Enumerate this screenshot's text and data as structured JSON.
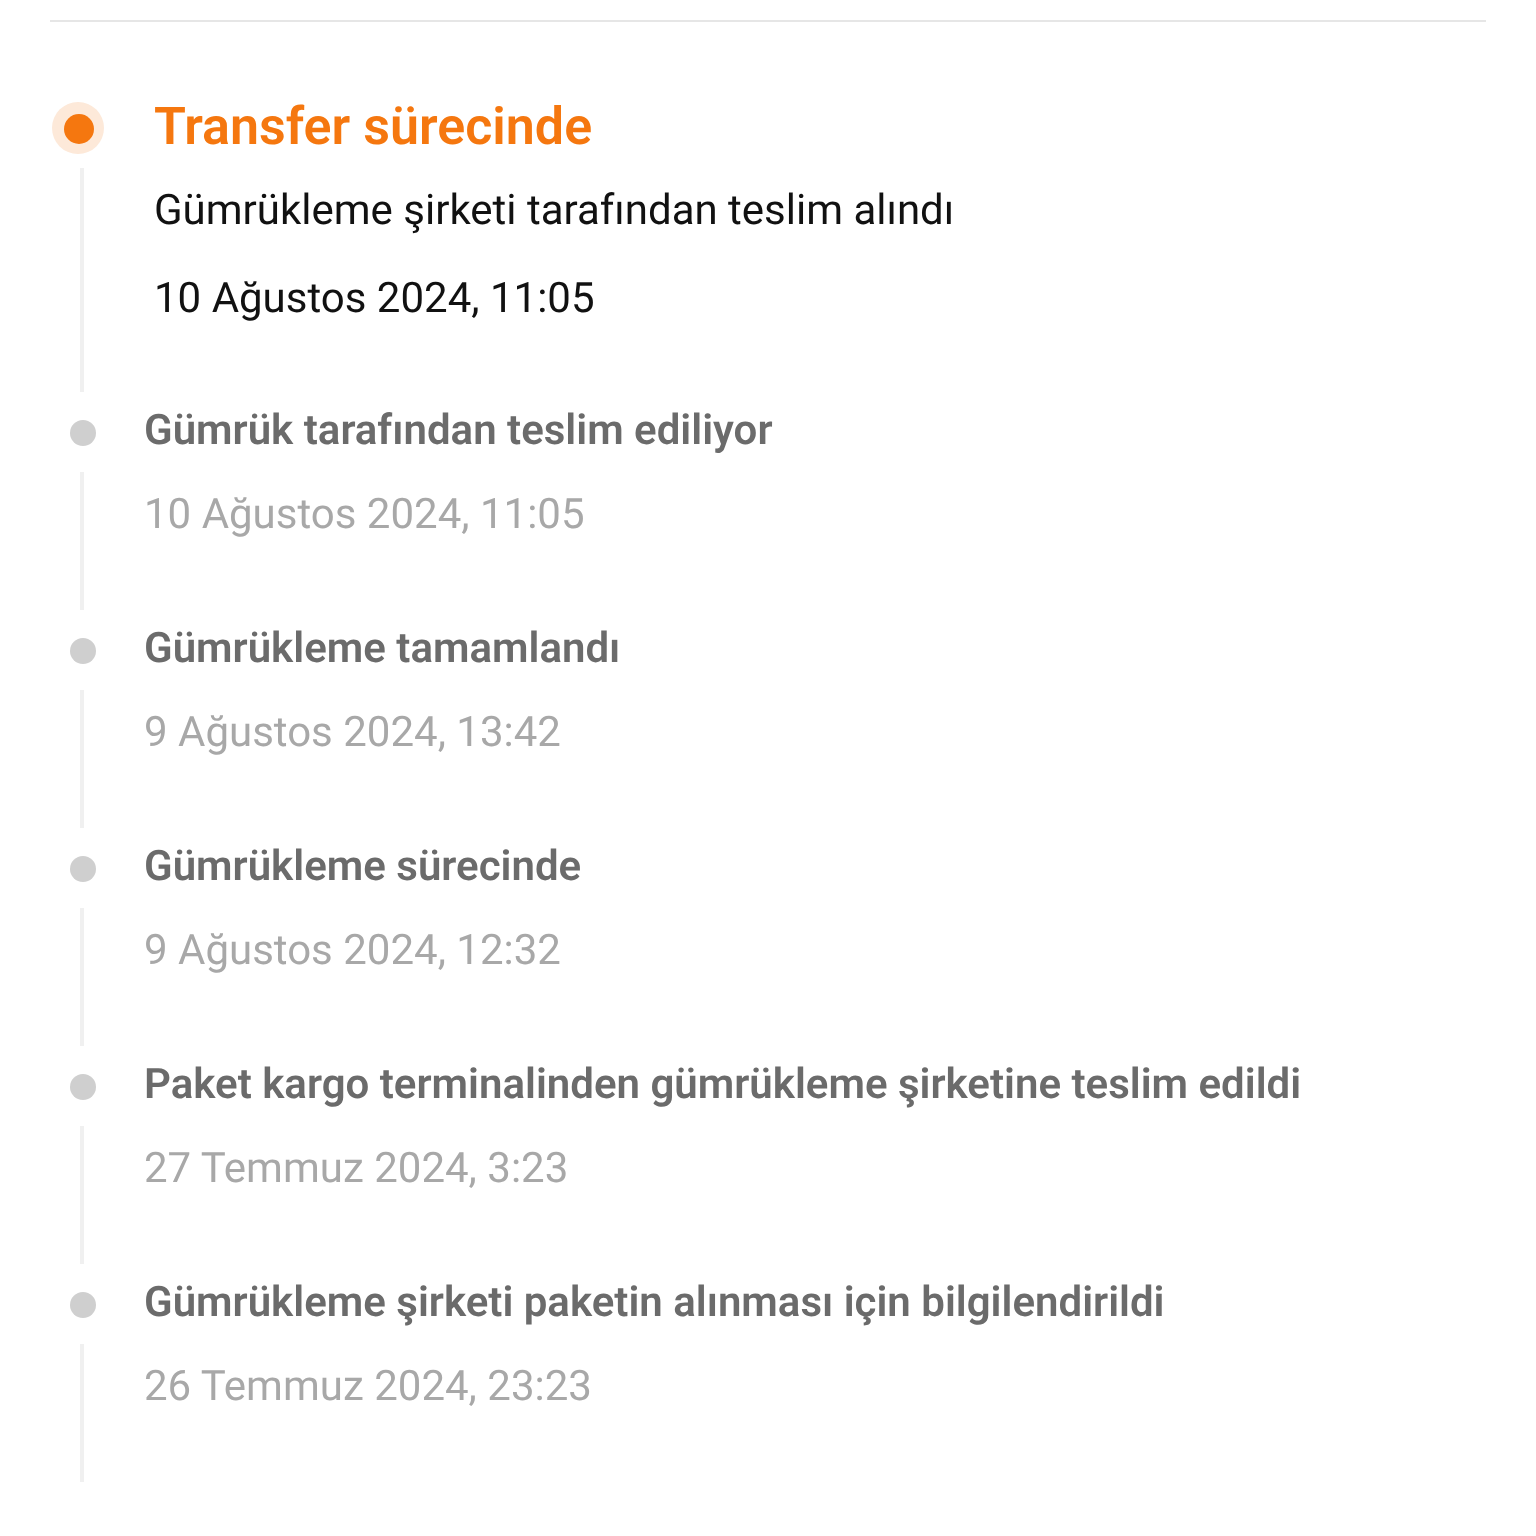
{
  "events": [
    {
      "title": "Transfer sürecinde",
      "detail": "Gümrükleme şirketi tarafından teslim alındı",
      "date": "10 Ağustos 2024, 11:05",
      "active": true
    },
    {
      "title": "Gümrük tarafından teslim ediliyor",
      "date": "10 Ağustos 2024, 11:05",
      "active": false
    },
    {
      "title": "Gümrükleme tamamlandı",
      "date": "9 Ağustos 2024, 13:42",
      "active": false
    },
    {
      "title": "Gümrükleme sürecinde",
      "date": "9 Ağustos 2024, 12:32",
      "active": false
    },
    {
      "title": "Paket kargo terminalinden gümrükleme şirketine teslim edildi",
      "date": "27 Temmuz 2024, 3:23",
      "active": false
    },
    {
      "title": "Gümrükleme şirketi paketin alınması için bilgilendirildi",
      "date": "26 Temmuz 2024, 23:23",
      "active": false
    }
  ]
}
